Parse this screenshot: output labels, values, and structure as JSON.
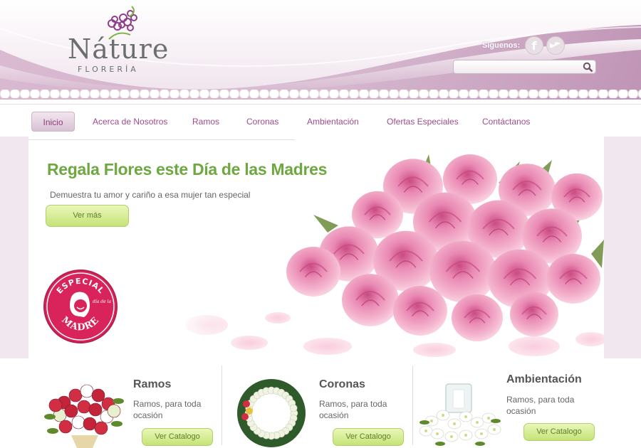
{
  "brand": {
    "name": "Náture",
    "subtitle": "FLORERÍA"
  },
  "header": {
    "social_label": "Siguenos:",
    "social": [
      {
        "name": "facebook-icon",
        "glyph": "f"
      },
      {
        "name": "twitter-icon",
        "glyph": "t"
      }
    ],
    "search_placeholder": ""
  },
  "nav": {
    "items": [
      {
        "label": "Inicio",
        "active": true
      },
      {
        "label": "Acerca de Nosotros",
        "active": false
      },
      {
        "label": "Ramos",
        "active": false
      },
      {
        "label": "Coronas",
        "active": false
      },
      {
        "label": "Ambientación",
        "active": false
      },
      {
        "label": "Ofertas Especiales",
        "active": false
      },
      {
        "label": "Contáctanos",
        "active": false
      }
    ]
  },
  "banner": {
    "title": "Regala Flores este Día de las Madres",
    "text": "Demuestra tu amor y cariño a esa mujer tan especial",
    "button": "Ver más",
    "badge": {
      "top": "ESPECIAL",
      "small": "día de la",
      "bottom": "MADRE"
    }
  },
  "products": [
    {
      "title": "Ramos",
      "desc": "Ramos, para toda ocasión",
      "button": "Ver Catalogo",
      "icon": "bouquet-image"
    },
    {
      "title": "Coronas",
      "desc": "Ramos, para toda ocasión",
      "button": "Ver Catalogo",
      "icon": "wreath-image"
    },
    {
      "title": "Ambientación",
      "desc": "Ramos, para toda ocasión",
      "button": "Ver Catalogo",
      "icon": "arrangement-image"
    }
  ],
  "colors": {
    "accent_purple": "#a14a8e",
    "accent_green": "#6da840",
    "badge_red": "#d8245a"
  }
}
